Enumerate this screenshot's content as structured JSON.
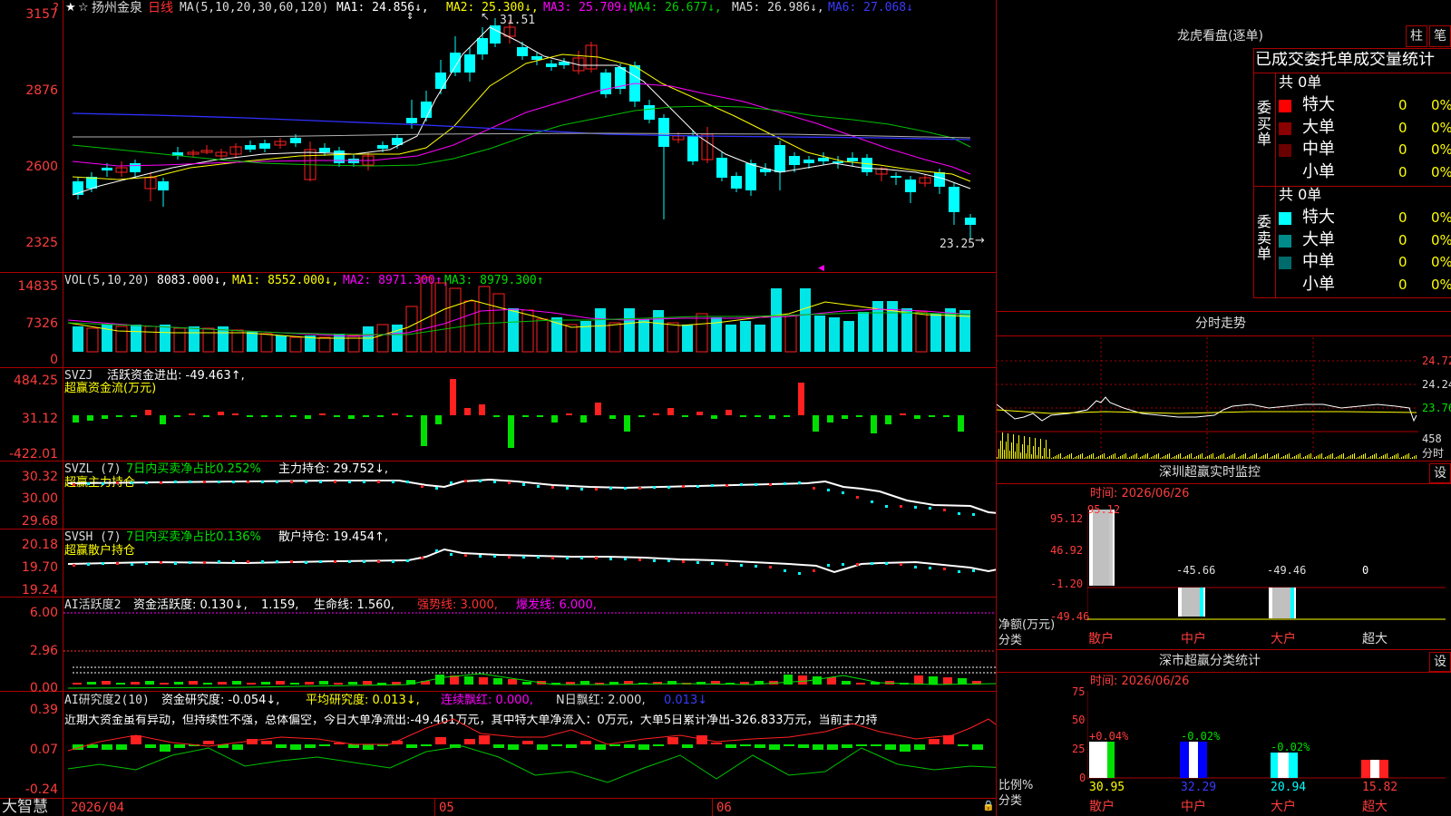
{
  "colors": {
    "up": "#ff2020",
    "down": "#00ffff",
    "vol_down": "#00e5e5",
    "green": "#00e000",
    "frame": "#aa0000",
    "axis_text": "#ff3c3c",
    "white": "#ffffff",
    "yellow": "#ffff00",
    "magenta": "#ff00ff",
    "ma_green": "#00c000",
    "blue": "#3030ff"
  },
  "main": {
    "title_icons": "★",
    "stock_name": "扬州金泉",
    "period": "日线",
    "ma_params": "MA(5,10,20,30,60,120)",
    "ma1": "MA1: 24.856↓,",
    "ma2": "MA2: 25.300↓,",
    "ma3": "MA3: 25.709↓,",
    "ma4": "MA4: 26.677↓,",
    "ma5": "MA5: 26.986↓,",
    "ma6": "MA6: 27.068↓",
    "axis": [
      "3157",
      "2876",
      "2600",
      "2325"
    ],
    "high_label": "31.51",
    "low_label": "23.25",
    "corner_marker": "?"
  },
  "vol": {
    "title": "VOL(5,10,20)",
    "value": "8083.000↓,",
    "ma1": "MA1: 8552.000↓,",
    "ma2": "MA2: 8971.300↑,",
    "ma3": "MA3: 8979.300↑",
    "axis": [
      "14835",
      "7326",
      "0"
    ]
  },
  "svzj": {
    "title": "SVZJ",
    "label": "活跃资金进出: -49.463↑,",
    "subtitle": "超赢资金流(万元)",
    "axis": [
      "484.25",
      "31.12",
      "-422.01"
    ]
  },
  "svzl": {
    "title": "SVZL (7)",
    "ratio": "7日内买卖净占比0.252%",
    "hold": "主力持仓: 29.752↓,",
    "subtitle": "超赢主力持仓",
    "axis": [
      "30.32",
      "30.00",
      "29.68"
    ]
  },
  "svsh": {
    "title": "SVSH (7)",
    "ratio": "7日内买卖净占比0.136%",
    "hold": "散户持仓: 19.454↑,",
    "subtitle": "超赢散户持仓",
    "axis": [
      "20.18",
      "19.70",
      "19.24"
    ]
  },
  "ai_active": {
    "title": "AI活跃度2",
    "a": "资金活跃度: 0.130↓,",
    "b": "1.159,",
    "c": "生命线: 1.560,",
    "d": "强势线: 3.000,",
    "e": "爆发线: 6.000,",
    "axis": [
      "6.00",
      "2.96",
      "0.00"
    ]
  },
  "ai_research": {
    "title": "AI研究度2(10)",
    "a": "资金研究度: -0.054↓,",
    "b": "平均研究度: 0.013↓,",
    "c": "连续飘红: 0.000,",
    "d": "N日飘红: 2.000,",
    "e": "0.013↓",
    "desc": "近期大资金虽有异动，但持续性不强，总体偏空，今日大单净流出:-49.461万元，其中特大单净流入：0万元，大单5日累计净出-326.833万元，当前主力持",
    "axis": [
      "0.39",
      "0.07",
      "-0.24"
    ]
  },
  "xaxis": {
    "labels": [
      "2026/04",
      "05",
      "06"
    ]
  },
  "brand": "大智慧",
  "lhb": {
    "title": "龙虎看盘(逐单)",
    "btn_zhu": "柱",
    "btn_bi": "笔",
    "tabs": "已成交委托单成交量统计",
    "buy": {
      "side": "委买单",
      "count": "共 0单",
      "rows": [
        {
          "name": "特大",
          "v": "0",
          "p": "0%"
        },
        {
          "name": "大单",
          "v": "0",
          "p": "0%"
        },
        {
          "name": "中单",
          "v": "0",
          "p": "0%"
        },
        {
          "name": "小单",
          "v": "0",
          "p": "0%"
        }
      ]
    },
    "sell": {
      "side": "委卖单",
      "count": "共 0单",
      "rows": [
        {
          "name": "特大",
          "v": "0",
          "p": "0%"
        },
        {
          "name": "大单",
          "v": "0",
          "p": "0%"
        },
        {
          "name": "中单",
          "v": "0",
          "p": "0%"
        },
        {
          "name": "小单",
          "v": "0",
          "p": "0%"
        }
      ]
    }
  },
  "fenshi": {
    "title": "分时走势",
    "axis": [
      "24.72",
      "24.24",
      "23.76"
    ],
    "vol": "458",
    "unit": "分时"
  },
  "monitor": {
    "title": "深圳超赢实时监控",
    "set": "设",
    "date": "时间: 2026/06/26",
    "axis": [
      "95.12",
      "46.92",
      "-1.20",
      "-49.46"
    ],
    "ylabel": "净额(万元)",
    "xlabel": "分类",
    "cats": [
      "散户",
      "中户",
      "大户",
      "超大"
    ],
    "values": [
      "95.12",
      "-45.66",
      "-49.46",
      "0"
    ]
  },
  "classify": {
    "title": "深市超赢分类统计",
    "set": "设",
    "date": "时间: 2026/06/26",
    "axis": [
      "75",
      "50",
      "25",
      "0"
    ],
    "ylabel": "比例%",
    "xlabel": "分类",
    "cats": [
      "散户",
      "中户",
      "大户",
      "超大"
    ],
    "top": [
      "+0.04%",
      "-0.02%",
      "-0.02%",
      ""
    ],
    "bottom": [
      "30.95",
      "32.29",
      "20.94",
      "15.82"
    ]
  }
}
